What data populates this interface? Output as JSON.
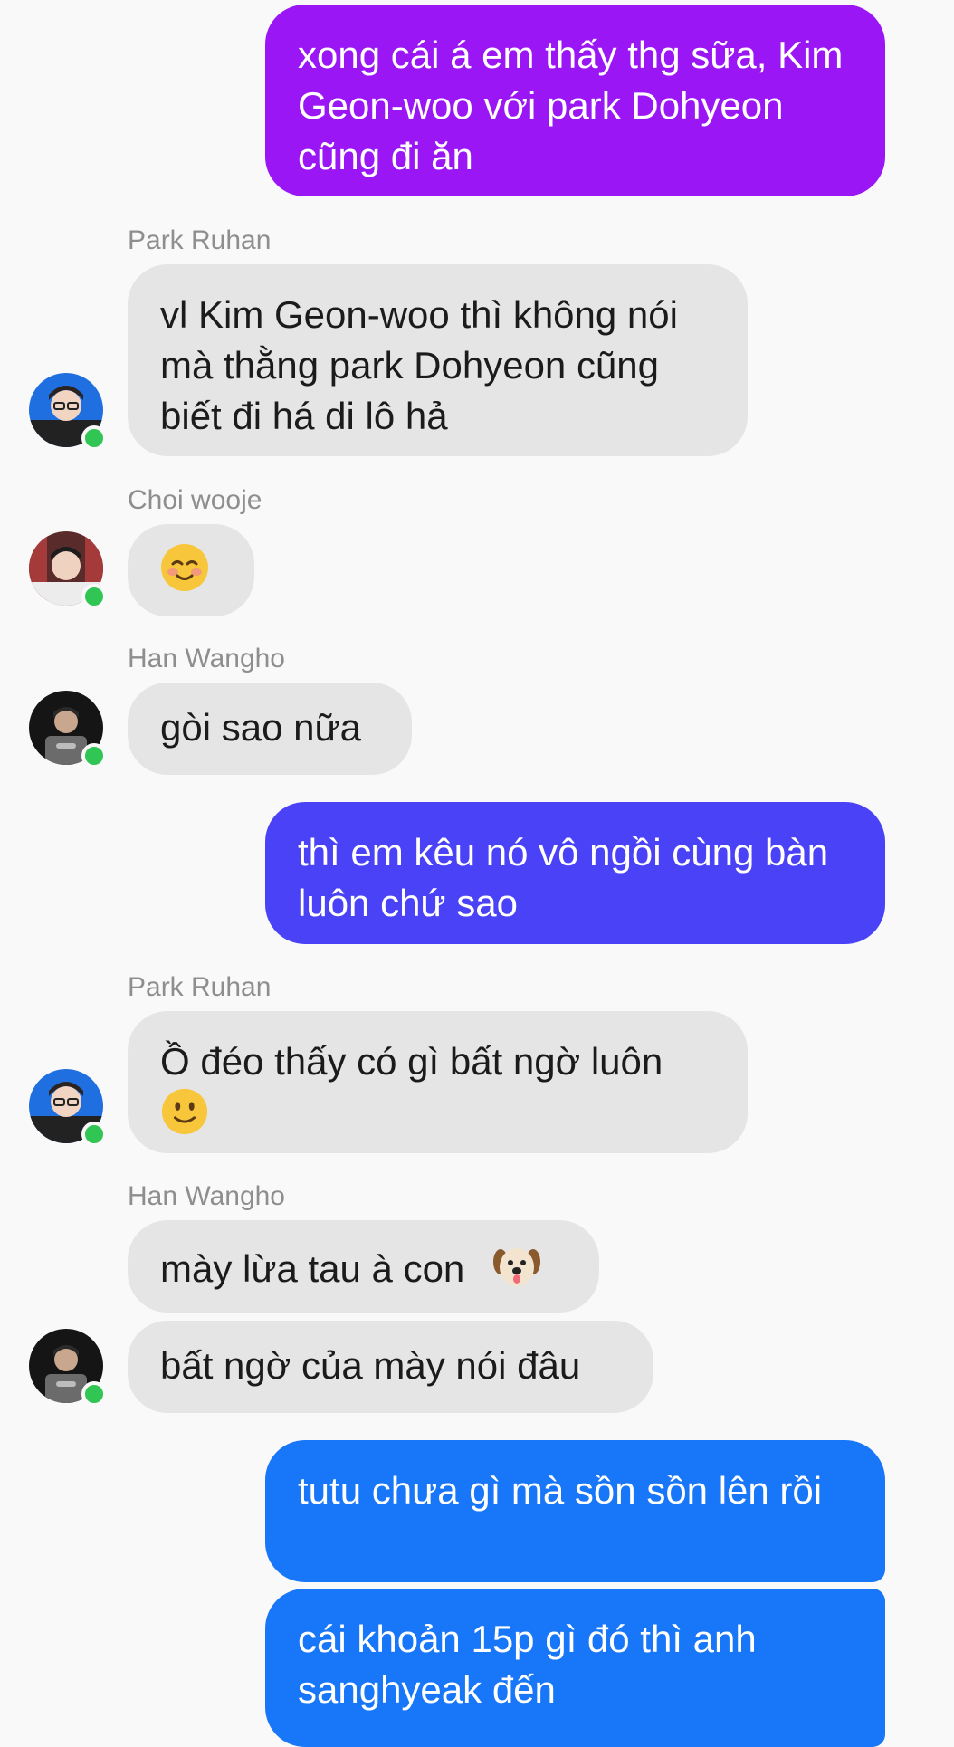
{
  "colors": {
    "background": "#f9f9f9",
    "incoming_bubble": "#e5e5e5",
    "outgoing_purple": "#9a16f5",
    "outgoing_indigo": "#4a42f6",
    "outgoing_blue": "#1876f8",
    "online_dot": "#31c553"
  },
  "messages": [
    {
      "direction": "outgoing",
      "text": "xong cái á em thấy thg sữa, Kim Geon-woo với park Dohyeon cũng đi ăn"
    },
    {
      "direction": "incoming",
      "sender": "Park Ruhan",
      "avatar_icon": "park-ruhan-avatar",
      "text": "vl Kim Geon-woo thì không nói mà thằng park Dohyeon cũng biết đi há di lô hả"
    },
    {
      "direction": "incoming",
      "sender": "Choi wooje",
      "avatar_icon": "choi-wooje-avatar",
      "emoji_icon": "smiling-blush-emoji"
    },
    {
      "direction": "incoming",
      "sender": "Han Wangho",
      "avatar_icon": "han-wangho-avatar",
      "text": "gòi sao nữa"
    },
    {
      "direction": "outgoing",
      "text": "thì em kêu nó vô ngồi cùng bàn luôn chứ sao"
    },
    {
      "direction": "incoming",
      "sender": "Park Ruhan",
      "avatar_icon": "park-ruhan-avatar",
      "text": "Ồ đéo thấy có gì bất ngờ luôn",
      "emoji_icon": "slight-smile-emoji"
    },
    {
      "direction": "incoming",
      "sender": "Han Wangho",
      "avatar_icon": "han-wangho-avatar",
      "text": "mày lừa tau à con",
      "emoji_icon": "dog-face-emoji"
    },
    {
      "direction": "incoming",
      "sender": "Han Wangho",
      "text": "bất ngờ của mày nói đâu"
    },
    {
      "direction": "outgoing",
      "text": "tutu chưa gì mà sồn sồn lên rồi"
    },
    {
      "direction": "outgoing",
      "text": "cái khoản 15p gì đó thì anh sanghyeak đến"
    }
  ]
}
